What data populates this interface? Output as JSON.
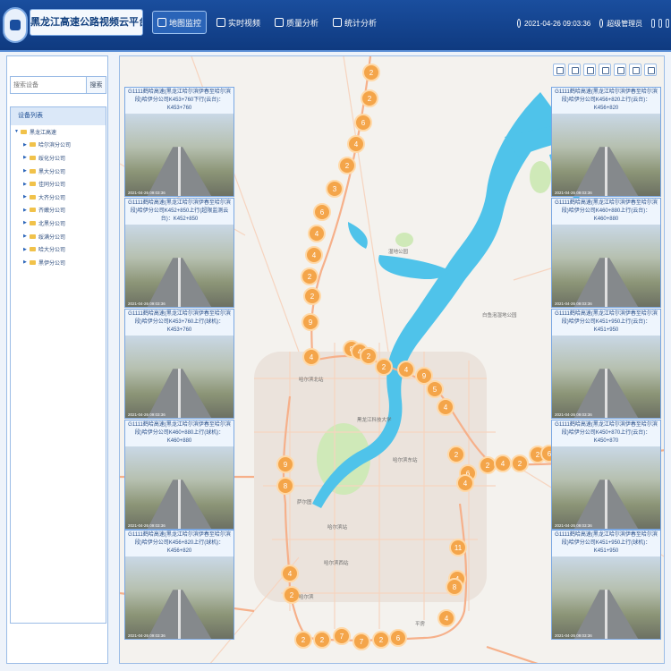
{
  "header": {
    "title": "黑龙江高速公路视频云平台",
    "nav": [
      {
        "label": "地图监控",
        "active": true
      },
      {
        "label": "实时视频",
        "active": false
      },
      {
        "label": "质量分析",
        "active": false
      },
      {
        "label": "统计分析",
        "active": false
      }
    ],
    "datetime": "2021-04-26 09:03:36",
    "user": "超级管理员"
  },
  "sidebar": {
    "search_placeholder": "搜索设备",
    "search_button": "搜索",
    "tree_title": "设备列表",
    "root": "黑龙江高速",
    "children": [
      "哈尔滨分公司",
      "绥化分公司",
      "黑大分公司",
      "佳同分公司",
      "大齐分公司",
      "齐嫩分公司",
      "北黑分公司",
      "绥满分公司",
      "哈大分公司",
      "黑伊分公司"
    ]
  },
  "map": {
    "labels": [
      "湿地公园",
      "哈尔滨北站",
      "黑龙江科技大学",
      "哈尔滨东站",
      "萨尔图",
      "哈尔滨站",
      "哈尔滨西站",
      "白鱼泡湿地公园",
      "哈尔滨",
      "平房"
    ],
    "clusters": [
      2,
      2,
      6,
      4,
      2,
      3,
      6,
      4,
      4,
      2,
      2,
      9,
      4,
      8,
      4,
      2,
      2,
      4,
      9,
      5,
      4,
      9,
      8,
      6,
      2,
      2,
      4,
      2,
      2,
      6,
      4,
      11,
      4,
      8,
      4,
      2,
      4,
      2,
      2,
      7,
      7,
      2,
      6
    ]
  },
  "cameras": [
    {
      "caption": "G1111鹤哈高速(黑龙江哈尔滨伊春至哈尔滨段)哈伊分公司K453+760下行(云台)：K453+760",
      "timestamp": "2021-04-26 09:03:36"
    },
    {
      "caption": "G1111鹤哈高速(黑龙江哈尔滨伊春至哈尔滨段)哈伊分公司K452+850上行(超限监测云台)：K452+850",
      "timestamp": "2021-04-26 09:03:36"
    },
    {
      "caption": "G1111鹤哈高速(黑龙江哈尔滨伊春至哈尔滨段)哈伊分公司K453+760上行(球机)：K453+760",
      "timestamp": "2021-04-26 09:03:36"
    },
    {
      "caption": "G1111鹤哈高速(黑龙江哈尔滨伊春至哈尔滨段)哈伊分公司K460+880上行(球机)：K460+880",
      "timestamp": "2021-04-26 09:03:36"
    },
    {
      "caption": "G1111鹤哈高速(黑龙江哈尔滨伊春至哈尔滨段)哈伊分公司K456+820上行(球机)：K456+820",
      "timestamp": "2021-04-26 09:03:36"
    },
    {
      "caption": "G1111鹤哈高速(黑龙江哈尔滨伊春至哈尔滨段)哈伊分公司K456+820上行(云台)：K456+820",
      "timestamp": "2021-04-26 09:03:36"
    },
    {
      "caption": "G1111鹤哈高速(黑龙江哈尔滨伊春至哈尔滨段)哈伊分公司K460+880上行(云台)：K460+880",
      "timestamp": "2021-04-26 09:03:36"
    },
    {
      "caption": "G1111鹤哈高速(黑龙江哈尔滨伊春至哈尔滨段)哈伊分公司K451+950上行(云台)：K451+950",
      "timestamp": "2021-04-26 09:03:36"
    },
    {
      "caption": "G1111鹤哈高速(黑龙江哈尔滨伊春至哈尔滨段)哈伊分公司K450+870上行(云台)：K450+870",
      "timestamp": "2021-04-26 09:03:36"
    },
    {
      "caption": "G1111鹤哈高速(黑龙江哈尔滨伊春至哈尔滨段)哈伊分公司K451+950上行(球机)：K451+950",
      "timestamp": "2021-04-26 09:03:36"
    }
  ],
  "colors": {
    "header": "#1a4e9e",
    "river": "#4fc3ea",
    "cluster": "#f4a54a",
    "road": "#f6b08a"
  }
}
